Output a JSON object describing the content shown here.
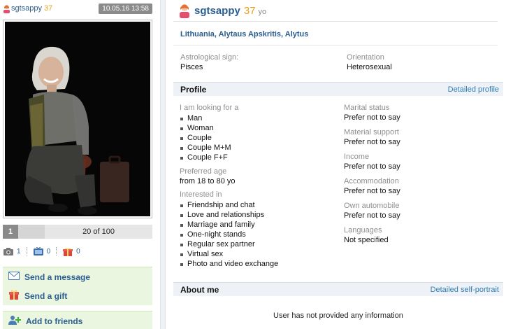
{
  "left": {
    "username": "sgtsappy",
    "age": "37",
    "date": "10.05.16 13:58",
    "pager": {
      "current": "1",
      "count": "20 of 100"
    },
    "counters": {
      "photos": "1",
      "videos": "0",
      "gifts": "0"
    },
    "actions": {
      "send_message": "Send a message",
      "send_gift": "Send a gift",
      "add_friends": "Add to friends"
    }
  },
  "profile_head": {
    "username": "sgtsappy",
    "age": "37",
    "yo": "yo",
    "location": "Lithuania, Alytaus Apskritis, Alytus"
  },
  "basics": {
    "astro_label": "Astrological sign:",
    "astro_value": "Pisces",
    "orient_label": "Orientation",
    "orient_value": "Heterosexual"
  },
  "profile_section": {
    "title": "Profile",
    "link": "Detailed profile",
    "looking_label": "I am looking for a",
    "looking_items": [
      "Man",
      "Woman",
      "Couple",
      "Couple M+M",
      "Couple F+F"
    ],
    "age_label": "Preferred age",
    "age_value": "from 18 to 80 yo",
    "interest_label": "Interested in",
    "interest_items": [
      "Friendship and chat",
      "Love and relationships",
      "Marriage and family",
      "One-night stands",
      "Regular sex partner",
      "Virtual sex",
      "Photo and video exchange"
    ],
    "marital_label": "Marital status",
    "marital_value": "Prefer not to say",
    "material_label": "Material support",
    "material_value": "Prefer not to say",
    "income_label": "Income",
    "income_value": "Prefer not to say",
    "accommodation_label": "Accommodation",
    "accommodation_value": "Prefer not to say",
    "auto_label": "Own automobile",
    "auto_value": "Prefer not to say",
    "languages_label": "Languages",
    "languages_value": "Not specified"
  },
  "about_section": {
    "title": "About me",
    "link": "Detailed self-portrait",
    "empty": "User has not provided any information"
  },
  "colors": {
    "link_blue": "#2a5d8f",
    "age_orange": "#e8a020",
    "action_bg": "#eaf6df",
    "section_bg": "#eef2f7"
  }
}
